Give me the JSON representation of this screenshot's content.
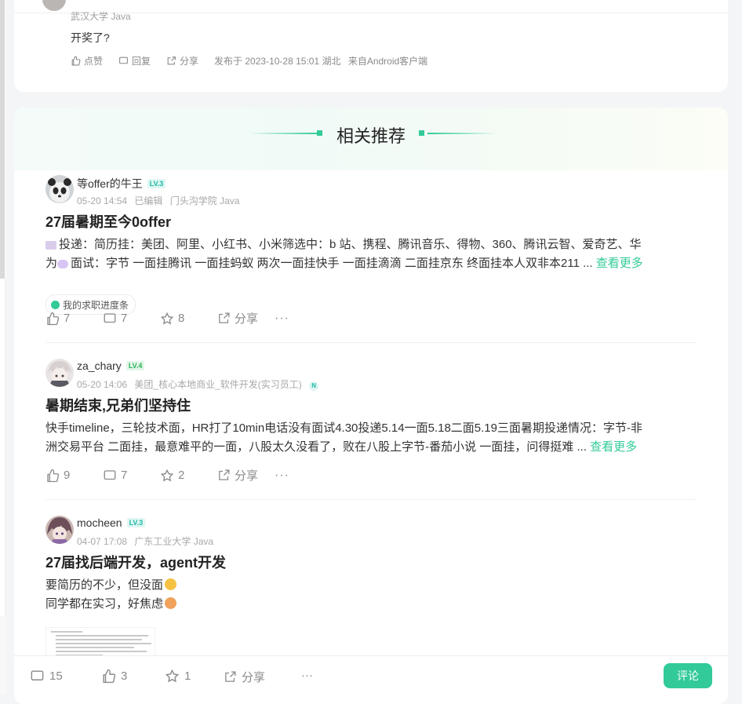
{
  "top_comment": {
    "meta_partial": "武汉大学 Java",
    "text": "开奖了?",
    "like_label": "点赞",
    "reply_label": "回复",
    "share_label": "分享",
    "published": "发布于 2023-10-28 15:01 湖北",
    "client": "来自Android客户端"
  },
  "section_title": "相关推荐",
  "posts": [
    {
      "username": "等offer的牛王",
      "level": "LV.3",
      "date": "05-20 14:54",
      "edited": "已编辑",
      "school": "门头沟学院 Java",
      "title": "27届暑期至今0offer",
      "body_line1": "投递：简历挂：美团、阿里、小红书、小米筛选中：b 站、携程、腾讯音乐、得物、360、腾讯云智、爱奇艺、华",
      "body_line2": "为",
      "body_line2b": "面试：字节 一面挂腾讯 一面挂蚂蚁 两次一面挂快手 一面挂滴滴 二面挂京东 终面挂本人双非本211 ...",
      "see_more": "查看更多",
      "tag": "我的求职进度条",
      "likes": "7",
      "comments": "7",
      "stars": "8",
      "share_label": "分享",
      "more_label": "···"
    },
    {
      "username": "za_chary",
      "level": "LV.4",
      "date": "05-20 14:06",
      "company": "美团_核心本地商业_软件开发(实习员工)",
      "company_badge": "N",
      "title": "暑期结束,兄弟们坚持住",
      "body_line1": "快手timeline，三轮技术面，HR打了10min电话没有面试4.30投递5.14一面5.18二面5.19三面暑期投递情况：字节-非",
      "body_line2": "洲交易平台 二面挂，最意难平的一面，八股太久没看了，败在八股上字节-番茄小说 一面挂，问得挺难 ...",
      "see_more": "查看更多",
      "likes": "9",
      "comments": "7",
      "stars": "2",
      "share_label": "分享",
      "more_label": "···"
    },
    {
      "username": "mocheen",
      "level": "LV.3",
      "date": "04-07 17:08",
      "school": "广东工业大学 Java",
      "title": "27届找后端开发，agent开发",
      "body_line1": "要简历的不少，但没面",
      "body_line2": "同学都在实习，好焦虑"
    }
  ],
  "bottom_bar": {
    "comments": "15",
    "likes": "3",
    "stars": "1",
    "share_label": "分享",
    "more_label": "···",
    "comment_button": "评论"
  },
  "colors": {
    "accent": "#32ca99",
    "text": "#333333",
    "muted": "#a8a8a8"
  }
}
